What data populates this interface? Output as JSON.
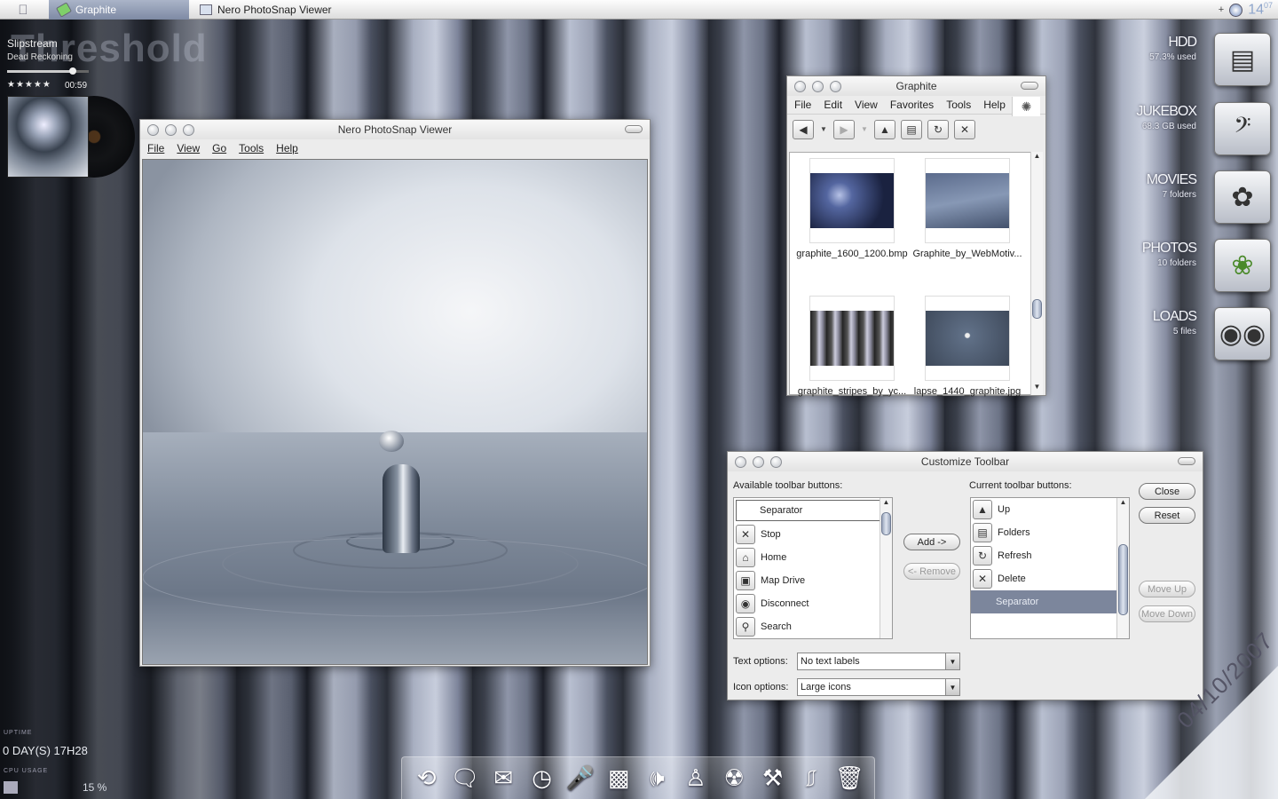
{
  "taskbar": {
    "task1": "Graphite",
    "task2": "Nero PhotoSnap Viewer",
    "time_hour": "14",
    "time_min": "07",
    "plus": "+"
  },
  "nowplaying": {
    "bg": "Threshold",
    "title": "Slipstream",
    "artist": "Dead Reckoning",
    "rating": "★★★★★",
    "time": "00:59",
    "progress": 0.8
  },
  "nero": {
    "title": "Nero PhotoSnap Viewer",
    "menu": [
      "File",
      "View",
      "Go",
      "Tools",
      "Help"
    ]
  },
  "graphite": {
    "title": "Graphite",
    "menu": [
      "File",
      "Edit",
      "View",
      "Favorites",
      "Tools",
      "Help"
    ],
    "files": [
      "graphite_1600_1200.bmp",
      "Graphite_by_WebMotiv...",
      "graphite_stripes_by_yc...",
      "lapse_1440_graphite.jpg"
    ]
  },
  "customize": {
    "title": "Customize Toolbar",
    "available_label": "Available toolbar buttons:",
    "current_label": "Current toolbar buttons:",
    "available": [
      "Separator",
      "Stop",
      "Home",
      "Map Drive",
      "Disconnect",
      "Search"
    ],
    "current": [
      "Up",
      "Folders",
      "Refresh",
      "Delete",
      "Separator"
    ],
    "add": "Add ->",
    "remove": "<- Remove",
    "close": "Close",
    "reset": "Reset",
    "move_up": "Move Up",
    "move_down": "Move Down",
    "text_options_label": "Text options:",
    "text_options_value": "No text labels",
    "icon_options_label": "Icon options:",
    "icon_options_value": "Large icons"
  },
  "drives": [
    {
      "name": "HDD",
      "sub": "57.3% used"
    },
    {
      "name": "JUKEBOX",
      "sub": "68.3 GB used"
    },
    {
      "name": "MOVIES",
      "sub": "7 folders"
    },
    {
      "name": "PHOTOS",
      "sub": "10 folders"
    },
    {
      "name": "LOADS",
      "sub": "5 files"
    }
  ],
  "system": {
    "uptime_label": "UPTIME",
    "uptime": "0 DAY(S) 17H28",
    "cpu_label": "CPU USAGE",
    "cpu": "15 %"
  },
  "date": "04/10/2007"
}
